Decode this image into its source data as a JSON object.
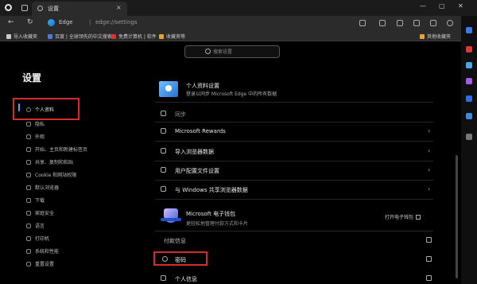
{
  "window": {
    "tab_title": "设置",
    "tab_close_glyph": "×",
    "controls": {
      "minimize": "—",
      "maximize": "▢",
      "close": "✕"
    }
  },
  "toolbar": {
    "back": "←",
    "refresh": "↻",
    "url_host": "Edge",
    "url_sep": "|",
    "url_path": "edge://settings"
  },
  "favorites": [
    {
      "label": "导入收藏夹",
      "color": "#c9c9c9"
    },
    {
      "label": "百度 | 全球领先的中文搜索",
      "color": "#4a7bd8"
    },
    {
      "label": "免费计算机 | 软件",
      "color": "#d83333"
    },
    {
      "label": "收藏夹等",
      "color": "#e3a33a"
    },
    {
      "label": "其他收藏夹",
      "color": "#e3a33a"
    }
  ],
  "search": {
    "placeholder": "搜索设置"
  },
  "sidebar": {
    "title": "设置",
    "items": [
      {
        "label": "个人资料"
      },
      {
        "label": "隐私"
      },
      {
        "label": "外观"
      },
      {
        "label": "开始、主页和新建标签页"
      },
      {
        "label": "共享、复制和粘贴"
      },
      {
        "label": "Cookie 和网站权限"
      },
      {
        "label": "默认浏览器"
      },
      {
        "label": "下载"
      },
      {
        "label": "家庭安全"
      },
      {
        "label": "语言"
      },
      {
        "label": "打印机"
      },
      {
        "label": "系统和性能"
      },
      {
        "label": "重置设置"
      }
    ]
  },
  "profile": {
    "name": "个人资料设置",
    "subtitle": "登录以同步 Microsoft Edge 中的所有数据"
  },
  "rows": {
    "sync": "同步",
    "rewards": "Microsoft Rewards",
    "import": "导入浏览器数据",
    "preferences": "用户配置文件设置",
    "windows": "与 Windows 共享浏览器数据",
    "wallet_name": "Microsoft 电子钱包",
    "wallet_sub": "更轻松地管理付款方式和卡片",
    "open_wallet": "打开电子钱包",
    "payment": "付款信息",
    "password": "密码",
    "personal": "个人信息"
  },
  "glyphs": {
    "chevron": "›"
  },
  "accent": "#4fa3ff",
  "highlight": "#d62b2b"
}
